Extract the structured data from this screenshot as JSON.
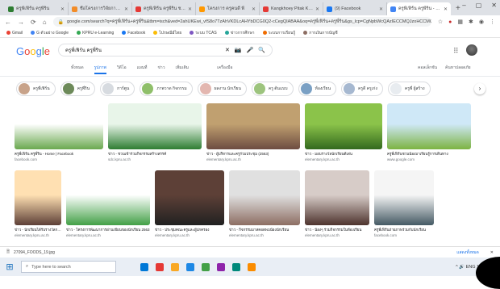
{
  "browser": {
    "tabs": [
      {
        "title": "ครูพี่เฟิร์น ครูพี่ริน",
        "fav": "#2e7d32"
      },
      {
        "title": "ชื่อโครงการวิจัยการศึกษา",
        "fav": "#f28c28"
      },
      {
        "title": "ครูพี่เฟิร์น ครูพี่ริน ชวนคุณ",
        "fav": "#e53935"
      },
      {
        "title": "โครงการ ครูคนดี พี่",
        "fav": "#ff9800"
      },
      {
        "title": "Kangkhoey Pitak Kiptu",
        "fav": "#e53935"
      },
      {
        "title": "(9) Facebook",
        "fav": "#1877f2"
      },
      {
        "title": "ครูพี่เฟิร์น ครูพี่ริน - Google",
        "fav": "#4285f4"
      }
    ],
    "new_tab": "+",
    "window_controls": [
      "–",
      "▢",
      "✕"
    ],
    "url": "google.com/search?q=ครูพี่เฟิร์น+ครูพี่ริน&tbm=isch&ved=2ahUKEwi_vfS8o7TzAhVKDLcAHYbDCG0Q2-cCegQIABAA&oq=ครูพี่เฟิร์น+ครูพี่ริน&gs_lcp=CgNpbWcQAzIECCMQJzoHCCMQ",
    "bookmarks": [
      {
        "label": "Gmail",
        "color": "#ea4335"
      },
      {
        "label": "G ตัวอย่าง Google",
        "color": "#4285f4"
      },
      {
        "label": "KPRU e-Learning",
        "color": "#34a853"
      },
      {
        "label": "Facebook",
        "color": "#1877f2"
      },
      {
        "label": "ไปรษณีย์ไทย",
        "color": "#fbbc05"
      },
      {
        "label": "ระบบ TCAS",
        "color": "#7e57c2"
      },
      {
        "label": "ข่าวการศึกษา",
        "color": "#26a69a"
      },
      {
        "label": "ระบบการเรียนรู้",
        "color": "#ef6c00"
      },
      {
        "label": "การเงินการบัญชี",
        "color": "#8d6e63"
      }
    ]
  },
  "google": {
    "logo": "Google",
    "query": "ครูพี่เฟิร์น ครูพี่ริน",
    "tabs": [
      "ทั้งหมด",
      "รูปภาพ",
      "วิดีโอ",
      "แผนที่",
      "ข่าว",
      "เพิ่มเติม",
      "เครื่องมือ"
    ],
    "tools": [
      "คอลเล็กชัน",
      "ค้นหาปลอดภัย"
    ],
    "chips": [
      {
        "label": "ครูพี่เฟิร์น",
        "color": "#c8a38a"
      },
      {
        "label": "ครูพี่ริน",
        "color": "#6d8a5a"
      },
      {
        "label": "การ์ตูน",
        "color": "#d7dbe0"
      },
      {
        "label": "ภาพวาด กิจกรรม",
        "color": "#8fbf6a"
      },
      {
        "label": "ผลงาน นักเรียน",
        "color": "#e3b7b0"
      },
      {
        "label": "ครู ต้นแบบ",
        "color": "#9dc47e"
      },
      {
        "label": "ห้องเรียน",
        "color": "#7aa0c4"
      },
      {
        "label": "ครูดี ครูเก่ง",
        "color": "#a6b8d0"
      },
      {
        "label": "ครูพี่ ผู้สร้าง",
        "color": "#e8ecf0"
      }
    ],
    "row1": [
      {
        "caption": "ครูพี่เฟิร์น ครูพี่ริน - Home | Facebook",
        "source": "facebook.com",
        "bg1": "#ffffff",
        "bg2": "#6aa84f"
      },
      {
        "caption": "ข่าว - ชวนเข้าร่วมกิจกรรมสร้างสรรค์",
        "source": "sdc.kpru.ac.th",
        "bg1": "#e8f5e9",
        "bg2": "#2e7d32"
      },
      {
        "caption": "ข่าว - ผู้บริหารและครูร่วมประชุม (2563)",
        "source": "elementary.kpru.ac.th",
        "bg1": "#c0a070",
        "bg2": "#6d4c41"
      },
      {
        "caption": "ข่าว - มอบรางวัลนักเรียนดีเด่น",
        "source": "elementary.kpru.ac.th",
        "bg1": "#8bc34a",
        "bg2": "#33691e"
      },
      {
        "caption": "ครูพี่เฟิร์นชวนน้องมาเรียนรู้การเดินทาง",
        "source": "www.google.com",
        "bg1": "#cfe8f7",
        "bg2": "#7cb342"
      }
    ],
    "row2": [
      {
        "caption": "ข่าว - นักเรียนได้รับรางวัลการประกวด",
        "source": "elementary.kpru.ac.th",
        "bg1": "#ffe0b2",
        "bg2": "#5d4037"
      },
      {
        "caption": "ข่าว - โครงการพัฒนาการอ่านเขียนของนักเรียน 2563",
        "source": "elementary.kpru.ac.th",
        "bg1": "#ffffff",
        "bg2": "#43a047"
      },
      {
        "caption": "ข่าว - ประชุมคณะครูและผู้ปกครอง",
        "source": "elementary.kpru.ac.th",
        "bg1": "#5d4037",
        "bg2": "#212121"
      },
      {
        "caption": "ข่าว - กิจกรรมมาสคอตพบน้องนักเรียน",
        "source": "elementary.kpru.ac.th",
        "bg1": "#e0e0e0",
        "bg2": "#8d6e63"
      },
      {
        "caption": "ข่าว - น้องๆ ร่วมกิจกรรมในห้องเรียน",
        "source": "elementary.kpru.ac.th",
        "bg1": "#d7ccc8",
        "bg2": "#4e342e"
      },
      {
        "caption": "ครูพี่เฟิร์นถ่ายภาพร่วมกับนักเรียน",
        "source": "facebook.com",
        "bg1": "#f5f5f5",
        "bg2": "#455a64"
      }
    ]
  },
  "download_bar": {
    "file": "27094_FOODS_19.jpg",
    "show_all": "แสดงทั้งหมด",
    "close": "✕"
  },
  "taskbar": {
    "search_placeholder": "Type here to search",
    "apps": [
      "#0078d7",
      "#e53935",
      "#f9a825",
      "#1e88e5",
      "#43a047",
      "#8e24aa",
      "#00897b",
      "#fb8c00"
    ],
    "tray": "^ 🔊 ENG 16:42"
  }
}
